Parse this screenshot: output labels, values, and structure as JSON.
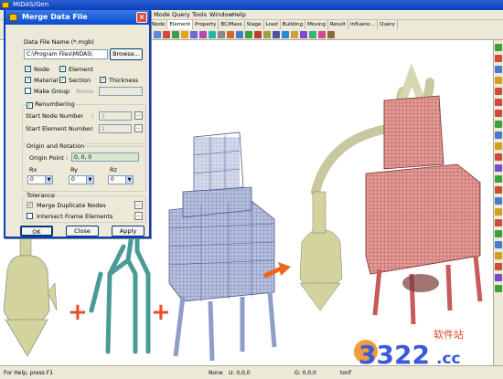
{
  "app": {
    "title": "MIDAS/Gen"
  },
  "menu": {
    "items": [
      "Mode",
      "Query",
      "Tools",
      "Window",
      "Help"
    ]
  },
  "tabs": [
    "Node",
    "Element",
    "Property",
    "BC/Mass",
    "Stage",
    "Load",
    "Building",
    "Moving",
    "Result",
    "Influenc...",
    "Query"
  ],
  "dialog": {
    "title": "Merge Data File",
    "file_label": "Data File Name (*.mgb)",
    "file_value": "C:\\Program Files\\MIDAS\\",
    "browse_label": "Browse...",
    "options": {
      "node": "Node",
      "element": "Element",
      "material": "Material",
      "section": "Section",
      "thickness": "Thickness",
      "make_group": "Make Group",
      "name_label": "Name"
    },
    "renumbering": {
      "label": "Renumbering",
      "start_node_label": "Start Node Number",
      "start_node_value": "1",
      "start_element_label": "Start Element Number",
      "start_element_value": "1"
    },
    "origin": {
      "group_label": "Origin and Rotation",
      "origin_point_label": "Origin Point :",
      "origin_point_value": "0, 0, 0",
      "rx_label": "Rx",
      "ry_label": "Ry",
      "rz_label": "Rz",
      "rx_value": "0",
      "ry_value": "0",
      "rz_value": "0"
    },
    "tolerance": {
      "group_label": "Tolerance",
      "merge_duplicate": "Merge Duplicate Nodes",
      "intersect_frame": "Intersect Frame Elements"
    },
    "ok_label": "OK",
    "close_label": "Close",
    "apply_label": "Apply"
  },
  "status": {
    "help": "For Help, press F1",
    "none": "None",
    "u": "U: 0,0,0",
    "g": "G: 0,0,0",
    "unit": "tonf"
  },
  "watermark": {
    "text": "3322",
    "suffix": ".cc",
    "chinese": "软件站"
  },
  "colors": {
    "title_blue": "#0a4bd0",
    "model_yellow": "#d8d8a0",
    "model_teal": "#4a9a98",
    "model_blue": "#8f9ec9",
    "model_red": "#c85a5a",
    "arrow_orange": "#f0641e"
  }
}
